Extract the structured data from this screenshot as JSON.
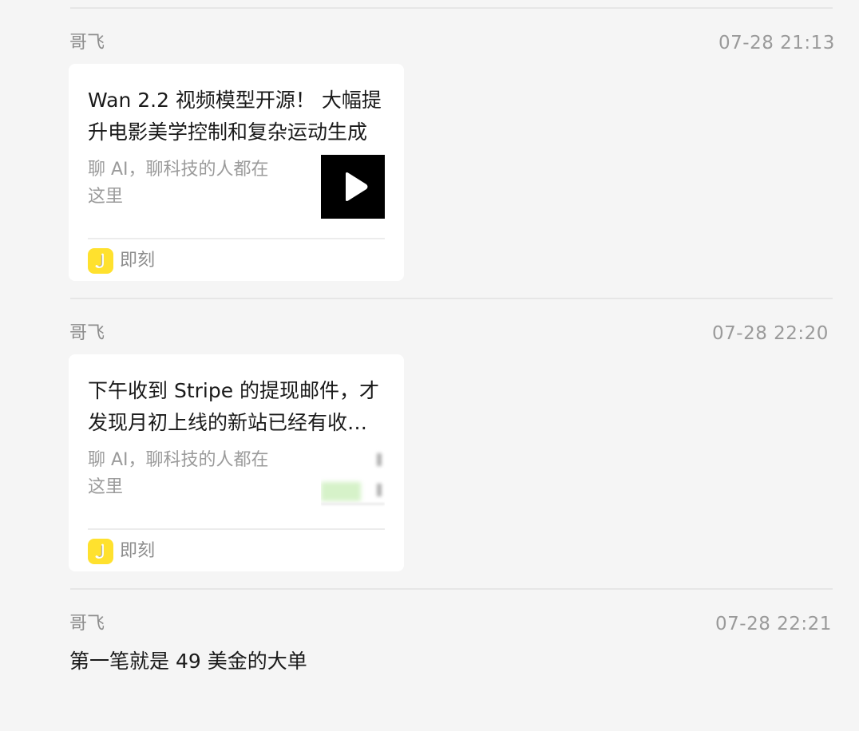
{
  "messages": [
    {
      "sender": "哥飞",
      "time": "07-28 21:13",
      "card": {
        "title": "Wan 2.2 视频模型开源！ 大幅提升电影美学控制和复杂运动生成",
        "desc_line1": "聊 AI，聊科技的人都在",
        "desc_line2": "这里",
        "thumbnail": "video-play",
        "source_icon": "jike-app-icon",
        "source_icon_letter": "J",
        "source": "即刻"
      }
    },
    {
      "sender": "哥飞",
      "time": "07-28 22:20",
      "card": {
        "title": "下午收到 Stripe 的提现邮件，才发现月初上线的新站已经有收入了",
        "desc_line1": "聊 AI，聊科技的人都在",
        "desc_line2": "这里",
        "thumbnail": "image-preview",
        "source_icon": "jike-app-icon",
        "source_icon_letter": "J",
        "source": "即刻"
      }
    },
    {
      "sender": "哥飞",
      "time": "07-28 22:21",
      "text": "第一笔就是 49 美金的大单"
    }
  ],
  "colors": {
    "background": "#f5f5f5",
    "card": "#ffffff",
    "jike_yellow": "#ffe12e",
    "meta_text": "#8c8c8c",
    "main_text": "#1a1a1a"
  }
}
